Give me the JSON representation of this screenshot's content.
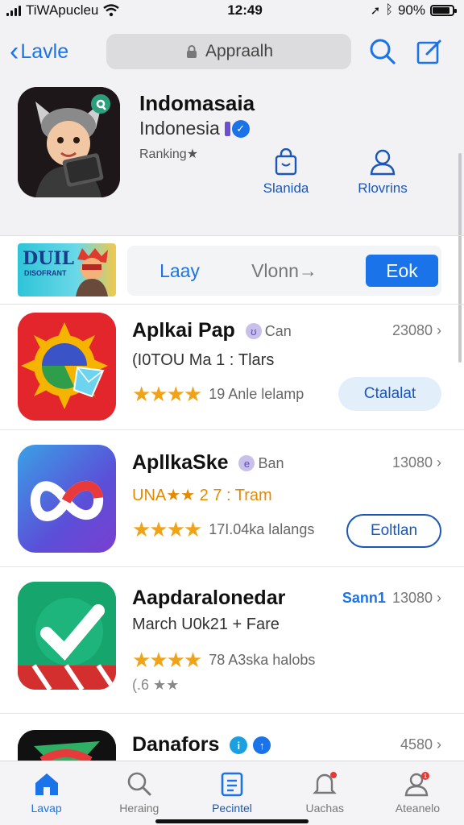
{
  "status_bar": {
    "carrier": "TiWApucleu",
    "time": "12:49",
    "battery": "90%",
    "battery_level": 0.9
  },
  "nav": {
    "back_label": "Lavle",
    "search_placeholder": "Appraalh"
  },
  "profile": {
    "title": "Indomasaia",
    "subtitle": "Indonesia",
    "ranking": "Ranking★",
    "actions": [
      {
        "label": "Slanida",
        "icon": "bag-icon"
      },
      {
        "label": "Rlovrins",
        "icon": "person-icon"
      }
    ]
  },
  "banner": {
    "promo_title": "DUIL",
    "promo_sub": "DISOFRANT",
    "segments": [
      "Laay",
      "Vlonn→",
      "Eok"
    ]
  },
  "apps": [
    {
      "name": "Aplkai Pap",
      "badge": "Can",
      "rank": "23080 ›",
      "line2": "(I0TOU Mа 1 : Tlars",
      "rating_text": "19 Anle lelamp",
      "button": "Ctalalat",
      "stars": 4,
      "accent": "#e53935"
    },
    {
      "name": "ApllkaSke",
      "badge": "Ban",
      "rank": "13080 ›",
      "line2": "UNA★★ 2 7 : Tram",
      "rating_text": "17I.04ka lalangs",
      "button": "Eoltlan",
      "stars": 4,
      "accent": "#5a46d6"
    },
    {
      "name": "Aapdaralonedar",
      "badge": "Sann1",
      "rank": "13080 ›",
      "line2": "March U0k21 + Fare",
      "rating_text": "78 A3ska halobs",
      "extra": "(.6 ★★",
      "stars": 4,
      "accent": "#1aa06e"
    },
    {
      "name": "Danafors",
      "badge": "",
      "rank": "4580 ›",
      "stars": 0,
      "accent": "#111111"
    }
  ],
  "tabs": [
    {
      "label": "Lavap",
      "icon": "home-icon",
      "active": true
    },
    {
      "label": "Heraing",
      "icon": "search-icon",
      "active": false
    },
    {
      "label": "Pecintel",
      "icon": "document-icon",
      "active": false
    },
    {
      "label": "Uachas",
      "icon": "bell-icon",
      "active": false
    },
    {
      "label": "Ateanelo",
      "icon": "account-icon",
      "active": false
    }
  ]
}
